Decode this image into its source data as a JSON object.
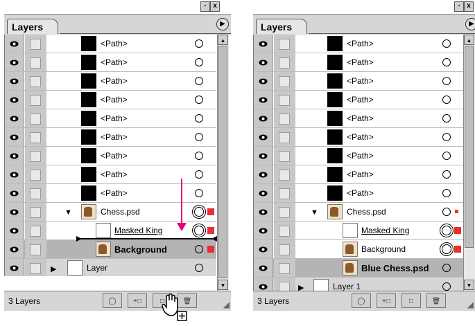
{
  "left_panel": {
    "tab_label": "Layers",
    "window_buttons": [
      "-",
      "x"
    ],
    "menu_icon": "menu-arrow",
    "rows": [
      {
        "label": "<Path>",
        "kind": "path"
      },
      {
        "label": "<Path>",
        "kind": "path"
      },
      {
        "label": "<Path>",
        "kind": "path"
      },
      {
        "label": "<Path>",
        "kind": "path"
      },
      {
        "label": "<Path>",
        "kind": "path"
      },
      {
        "label": "<Path>",
        "kind": "path"
      },
      {
        "label": "<Path>",
        "kind": "path"
      },
      {
        "label": "<Path>",
        "kind": "path"
      },
      {
        "label": "<Path>",
        "kind": "path"
      },
      {
        "label": "Chess.psd",
        "kind": "group"
      },
      {
        "label": "Masked King",
        "kind": "clip"
      },
      {
        "label": "Background",
        "kind": "selected"
      },
      {
        "label": "Layer",
        "kind": "layer"
      }
    ],
    "status": "3 Layers",
    "bottom_buttons": [
      "make-clipping-mask",
      "new-sublayer",
      "new-layer",
      "delete"
    ],
    "drag_arrow_color": "#e6007e"
  },
  "right_panel": {
    "tab_label": "Layers",
    "window_buttons": [
      "-",
      "x"
    ],
    "rows": [
      {
        "label": "<Path>",
        "kind": "path"
      },
      {
        "label": "<Path>",
        "kind": "path"
      },
      {
        "label": "<Path>",
        "kind": "path"
      },
      {
        "label": "<Path>",
        "kind": "path"
      },
      {
        "label": "<Path>",
        "kind": "path"
      },
      {
        "label": "<Path>",
        "kind": "path"
      },
      {
        "label": "<Path>",
        "kind": "path"
      },
      {
        "label": "<Path>",
        "kind": "path"
      },
      {
        "label": "<Path>",
        "kind": "path"
      },
      {
        "label": "Chess.psd",
        "kind": "group"
      },
      {
        "label": "Masked King",
        "kind": "clip"
      },
      {
        "label": "Background",
        "kind": "sub"
      },
      {
        "label": "Blue Chess.psd",
        "kind": "selected"
      },
      {
        "label": "Layer 1",
        "kind": "layer"
      }
    ],
    "status": "3 Layers"
  },
  "colors": {
    "selection": "#b4b4b4",
    "target_red": "#e83030",
    "arrow": "#e6007e"
  }
}
